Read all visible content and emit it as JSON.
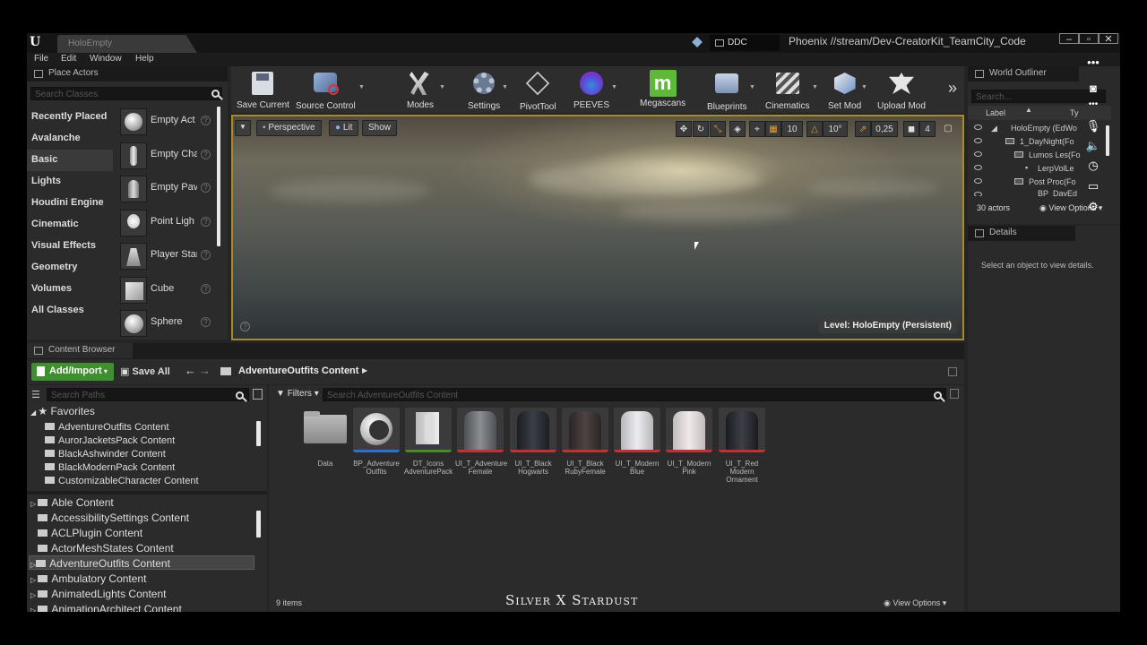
{
  "window": {
    "tab_title": "HoloEmpty",
    "ddc_label": "DDC",
    "stream_path": "Phoenix //stream/Dev-CreatorKit_TeamCity_Code"
  },
  "menu": [
    "File",
    "Edit",
    "Window",
    "Help"
  ],
  "place_actors": {
    "title": "Place Actors",
    "search_placeholder": "Search Classes",
    "categories": [
      "Recently Placed",
      "Avalanche",
      "Basic",
      "Lights",
      "Houdini Engine",
      "Cinematic",
      "Visual Effects",
      "Geometry",
      "Volumes",
      "All Classes"
    ],
    "selected_category": "Basic",
    "actors": [
      "Empty Act",
      "Empty Cha",
      "Empty Pav",
      "Point Ligh",
      "Player Star",
      "Cube",
      "Sphere"
    ],
    "help_glyph": "?"
  },
  "toolbar": {
    "buttons": [
      "Save Current",
      "Source Control",
      "Modes",
      "Settings",
      "PivotTool",
      "PEEVES",
      "Megascans",
      "Blueprints",
      "Cinematics",
      "Set Mod",
      "Upload Mod"
    ],
    "megascans_accent": "#5fb83a",
    "more": "»"
  },
  "viewport": {
    "perspective": "Perspective",
    "lit": "Lit",
    "show": "Show",
    "grid_snap": "10",
    "rot_snap": "10°",
    "scale_snap": "0,25",
    "cam_speed": "4",
    "level_label": "Level:  HoloEmpty (Persistent)",
    "highlight_color": "#a88a2a"
  },
  "outliner": {
    "title": "World Outliner",
    "search_placeholder": "Search...",
    "col_label": "Label",
    "col_type": "Ty",
    "rows": [
      "HoloEmpty (EdWo",
      "1_DayNight(Fo",
      "Lumos Les(Fo",
      "LerpVolLe",
      "Post Proc(Fo",
      "BP_DayEd"
    ],
    "actor_count": "30 actors",
    "view_options": "View Options"
  },
  "details": {
    "title": "Details",
    "empty_message": "Select an object to view details."
  },
  "content_browser": {
    "tab_title": "Content Browser",
    "add_import": "Add/Import",
    "save_all": "Save All",
    "path": "AdventureOutfits Content",
    "search_paths_placeholder": "Search Paths",
    "filters": "Filters",
    "search_content_placeholder": "Search AdventureOutfits Content",
    "favorites_label": "Favorites",
    "favorites": [
      "AdventureOutfits Content",
      "AurorJacketsPack Content",
      "BlackAshwinder Content",
      "BlackModernPack Content",
      "CustomizableCharacter Content"
    ],
    "folders": [
      "Able Content",
      "AccessibilitySettings Content",
      "ACLPlugin Content",
      "ActorMeshStates Content",
      "AdventureOutfits Content",
      "Ambulatory Content",
      "AnimatedLights Content",
      "AnimationArchitect Content"
    ],
    "selected_folder": "AdventureOutfits Content",
    "assets": [
      {
        "label": "Data",
        "kind": "folder"
      },
      {
        "label": "BP_Adventure Outfits",
        "kind": "blueprint"
      },
      {
        "label": "DT_Icons AdventurePack",
        "kind": "datatable"
      },
      {
        "label": "UI_T_Adventure Female",
        "kind": "jacket",
        "color": "#6b6e72"
      },
      {
        "label": "UI_T_Black Hogwarts",
        "kind": "jacket",
        "color": "#2a2d33"
      },
      {
        "label": "UI_T_Black RubyFemale",
        "kind": "jacket",
        "color": "#34302f"
      },
      {
        "label": "UI_T_Modern Blue",
        "kind": "jacket",
        "color": "#d8d8dc"
      },
      {
        "label": "UI_T_Modern Pink",
        "kind": "jacket",
        "color": "#dcd6d6"
      },
      {
        "label": "UI_T_Red Modern Ornament",
        "kind": "jacket",
        "color": "#282a30"
      }
    ],
    "item_count": "9 items",
    "view_options": "View Options"
  },
  "watermark": "Silver X Stardust"
}
